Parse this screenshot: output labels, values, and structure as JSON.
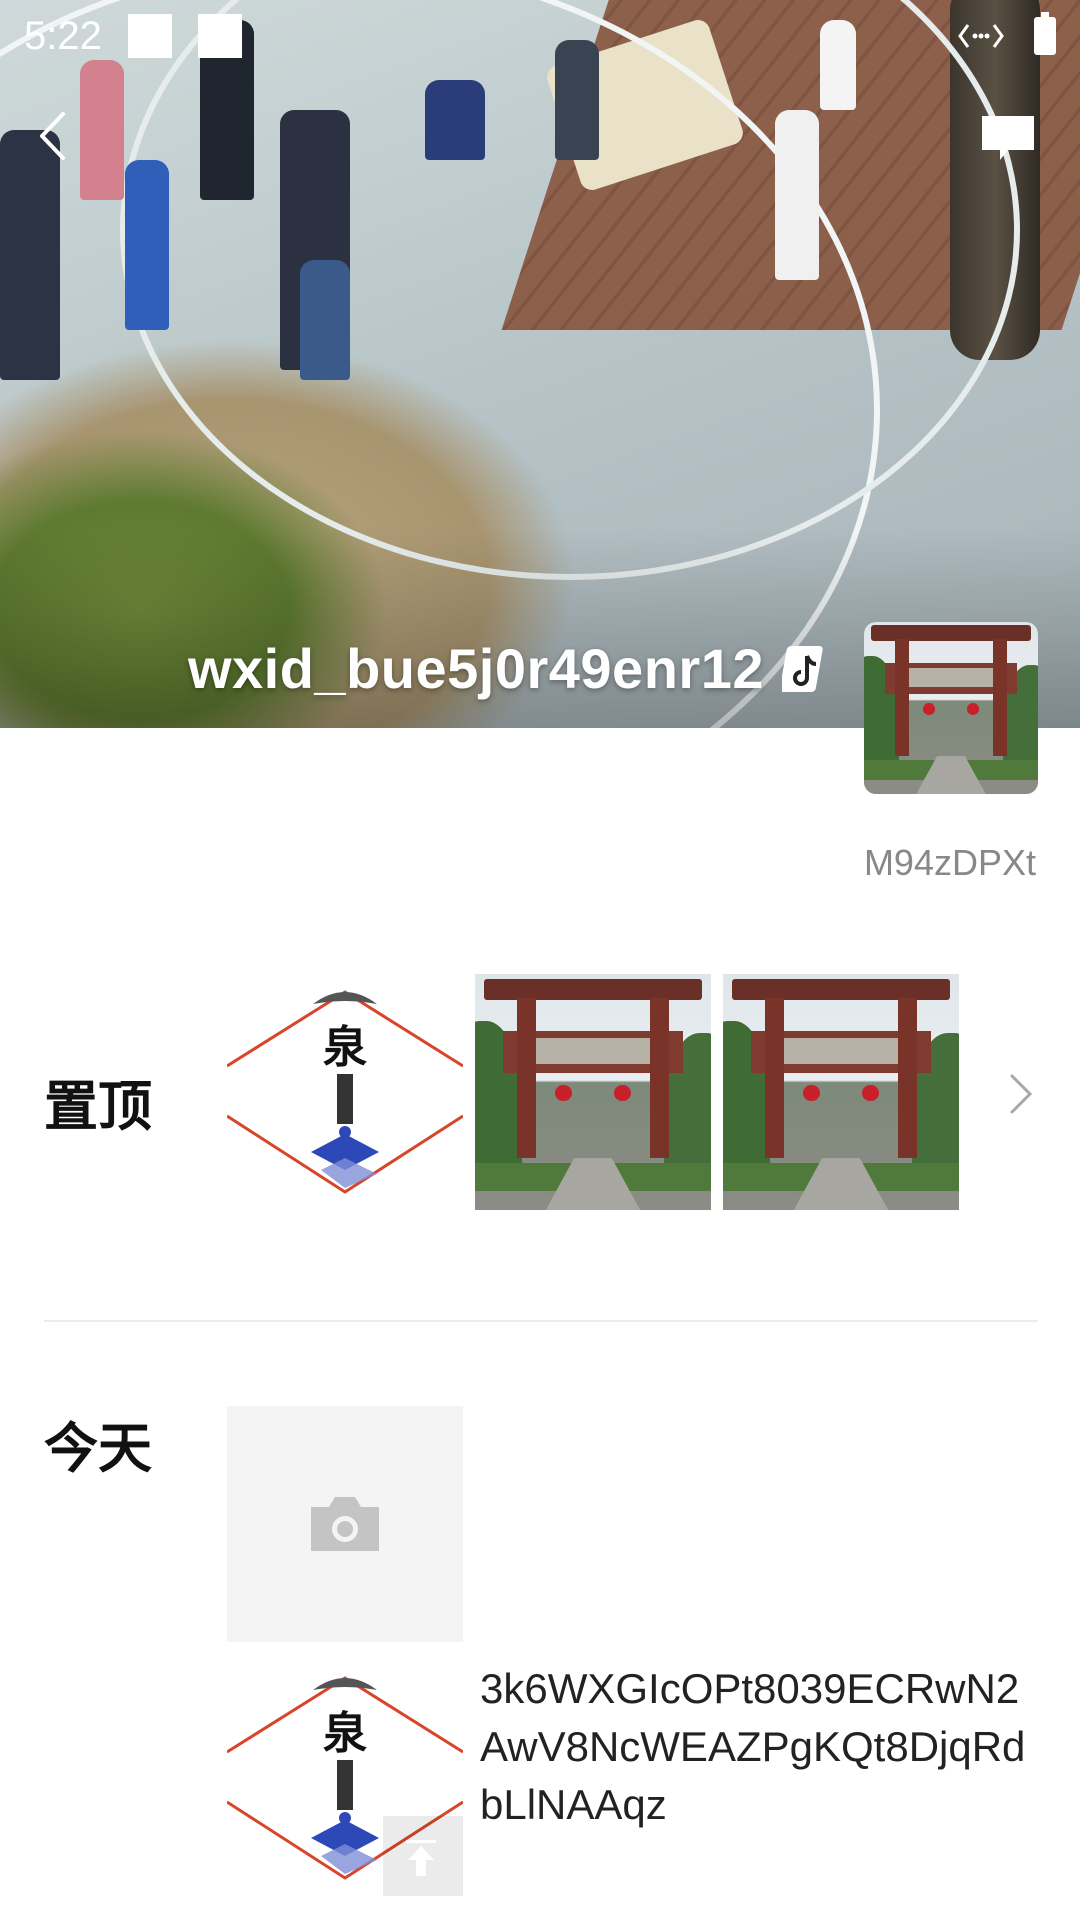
{
  "status_bar": {
    "time": "5:22"
  },
  "profile": {
    "username": "wxid_bue5j0r49enr12",
    "signature": "M94zDPXt"
  },
  "sections": {
    "pinned": {
      "label": "置顶"
    },
    "today": {
      "label": "今天",
      "post_text": "3k6WXGIcOPt8039ECRwN2AwV8NcWEAZPgKQt8DjqRdbLlNAAqz"
    }
  },
  "icons": {
    "back": "chevron-left-icon",
    "message": "message-icon",
    "tiktok": "tiktok-icon",
    "camera": "camera-icon",
    "chevron": "chevron-right-icon",
    "upload": "upload-icon"
  },
  "colors": {
    "logo_red": "#d8452a",
    "logo_blue": "#2d49b8"
  }
}
